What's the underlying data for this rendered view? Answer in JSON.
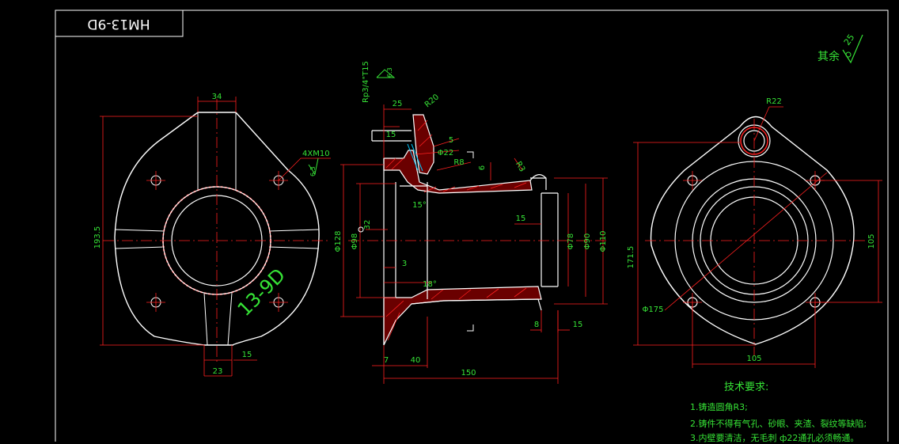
{
  "title_block": {
    "text": "HM13-9D",
    "mirrored": true
  },
  "surface_finish": {
    "rest_label": "其余",
    "roughness": "25"
  },
  "left_view": {
    "dims": {
      "top_width": "34",
      "height": "193.5",
      "bolt_spec": "4XM10",
      "bolt_finish": "6.3",
      "rib_width": "23",
      "rib_offset": "15"
    },
    "part_mark": "13-9D"
  },
  "section_view": {
    "thread_spec": "Rp3/4\"T15",
    "thread_finish": "6.3",
    "dims": {
      "d25": "25",
      "r20": "R20",
      "d15": "15",
      "d5": "5",
      "phi22": "Φ22",
      "r8": "R8",
      "d6": "6",
      "r3": "R3",
      "ang15": "15°",
      "d32": "32",
      "phi128": "Φ128",
      "phi98": "Φ98",
      "phi78": "Φ78",
      "phi90": "Φ90",
      "phi110": "Φ110",
      "d15b": "15",
      "d3": "3",
      "ang18": "18°",
      "d8": "8",
      "d15c": "15",
      "d7": "7",
      "d40": "40",
      "d150": "150"
    }
  },
  "right_view": {
    "dims": {
      "r22": "R22",
      "h1715": "171.5",
      "v105": "105",
      "h105": "105",
      "phi175": "Φ175"
    }
  },
  "requirements": {
    "heading": "技术要求:",
    "items": [
      "1.铸造圆角R3;",
      "2.铸件不得有气孔、砂眼、夹渣、裂纹等缺陷;",
      "3.内壁要清洁，无毛刺 ф22通孔必须畅通。"
    ]
  },
  "colors": {
    "outline": "#ffffff",
    "dimension": "#ff2020",
    "text": "#36e336",
    "center": "#ff2020",
    "hatch": "#ff2020",
    "accent": "#00c8ff",
    "mark": "#36e336"
  }
}
